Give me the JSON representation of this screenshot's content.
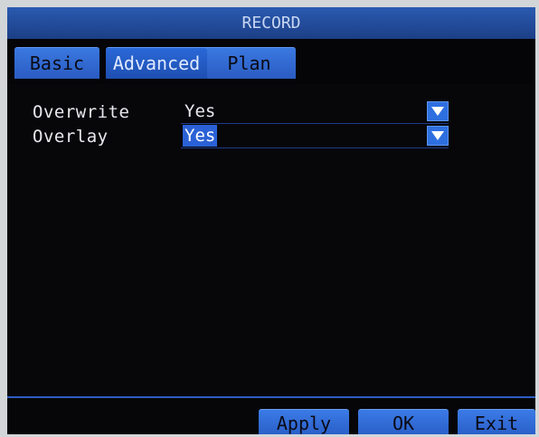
{
  "window": {
    "title": "RECORD"
  },
  "tabs": [
    {
      "label": "Basic",
      "active": false
    },
    {
      "label": "Advanced",
      "active": true
    },
    {
      "label": "Plan",
      "active": false
    }
  ],
  "settings": [
    {
      "label": "Overwrite",
      "value": "Yes",
      "selected": false,
      "icon": "chevron-down-icon"
    },
    {
      "label": "Overlay",
      "value": "Yes",
      "selected": true,
      "icon": "chevron-down-icon"
    }
  ],
  "footer": {
    "apply_label": "Apply",
    "ok_label": "OK",
    "exit_label": "Exit"
  },
  "colors": {
    "accent": "#2b61d6",
    "background": "#070709",
    "text": "#e8e8ee"
  }
}
